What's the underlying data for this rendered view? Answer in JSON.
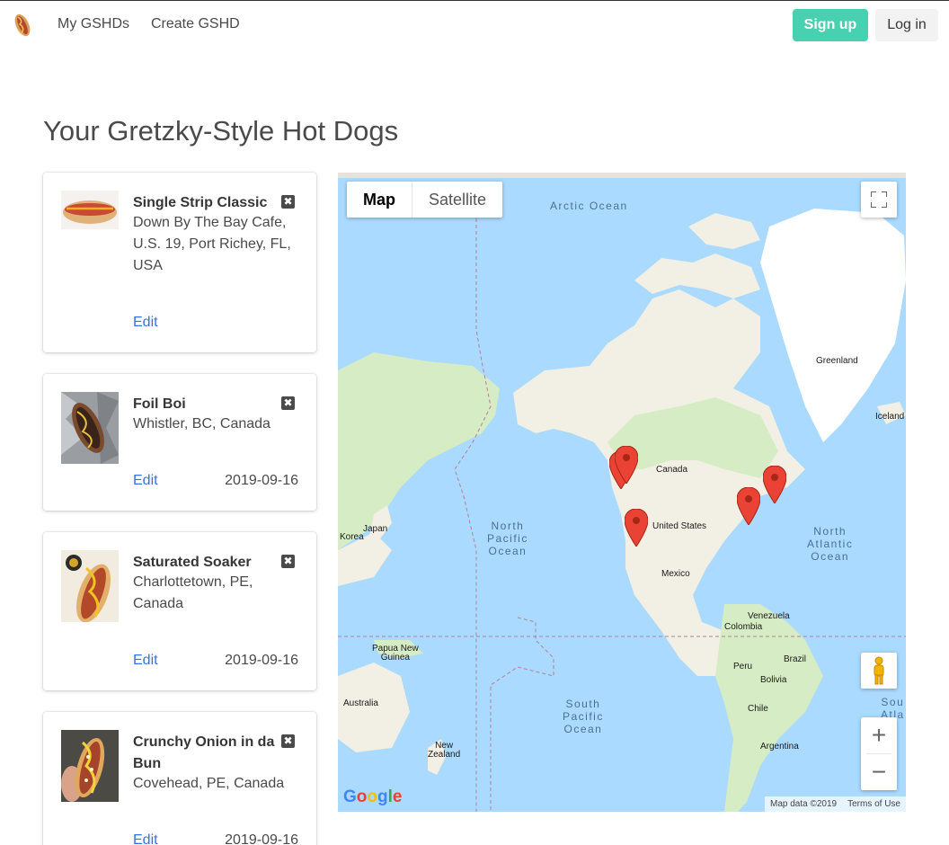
{
  "nav": {
    "logo_icon": "hot-dog-logo",
    "links": [
      "My GSHDs",
      "Create GSHD"
    ],
    "signup": "Sign up",
    "login": "Log in"
  },
  "page_title": "Your Gretzky-Style Hot Dogs",
  "cards": [
    {
      "title": "Single Strip Classic",
      "address": "Down By The Bay Cafe, U.S. 19, Port Richey, FL, USA",
      "edit": "Edit",
      "date": ""
    },
    {
      "title": "Foil Boi",
      "address": "Whistler, BC, Canada",
      "edit": "Edit",
      "date": "2019-09-16"
    },
    {
      "title": "Saturated Soaker",
      "address": "Charlottetown, PE, Canada",
      "edit": "Edit",
      "date": "2019-09-16"
    },
    {
      "title": "Crunchy Onion in da Bun",
      "address": "Covehead, PE, Canada",
      "edit": "Edit",
      "date": "2019-09-16"
    }
  ],
  "map": {
    "type_buttons": [
      "Map",
      "Satellite"
    ],
    "active_type": "Map",
    "labels": {
      "arctic": "Arctic Ocean",
      "north_pacific": [
        "North",
        "Pacific",
        "Ocean"
      ],
      "south_pacific": [
        "South",
        "Pacific",
        "Ocean"
      ],
      "north_atlantic": [
        "North",
        "Atlantic",
        "Ocean"
      ],
      "south_atlantic": [
        "Sou",
        "Atla"
      ],
      "greenland": "Greenland",
      "iceland": "Iceland",
      "canada": "Canada",
      "united_states": "United States",
      "mexico": "Mexico",
      "japan": "Japan",
      "korea": "Korea",
      "venezuela": "Venezuela",
      "colombia": "Colombia",
      "brazil": "Brazil",
      "peru": "Peru",
      "bolivia": "Bolivia",
      "chile": "Chile",
      "argentina": "Argentina",
      "papua": [
        "Papua New",
        "Guinea"
      ],
      "australia": "Australia",
      "new_zealand": [
        "New",
        "Zealand"
      ]
    },
    "google": "Google",
    "map_data": "Map data ©2019",
    "terms": "Terms of Use",
    "zoom_in": "+",
    "zoom_out": "−",
    "colors": {
      "water": "#aadaff",
      "land": "#f2efe4",
      "greenland": "#ffffff",
      "forest": "#cde6b8",
      "marker": "#ea4335"
    }
  }
}
